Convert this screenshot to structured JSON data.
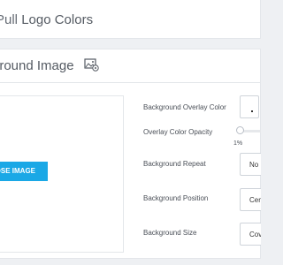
{
  "pull_logo": {
    "text_light": "Pull ",
    "text_strong": "Logo Colors"
  },
  "background": {
    "title": "ground Image",
    "image_icon": "image-settings-icon",
    "choose_button": "OSE IMAGE"
  },
  "settings": {
    "overlay_color_label": "Background Overlay Color",
    "opacity_label": "Overlay Color Opacity",
    "opacity_value": "1%",
    "opacity_fraction": 0.01,
    "repeat_label": "Background Repeat",
    "repeat_value": "No Re",
    "position_label": "Background Position",
    "position_value": "Cente",
    "size_label": "Background Size",
    "size_value": "Cove"
  },
  "colors": {
    "accent": "#1aa8e6"
  }
}
